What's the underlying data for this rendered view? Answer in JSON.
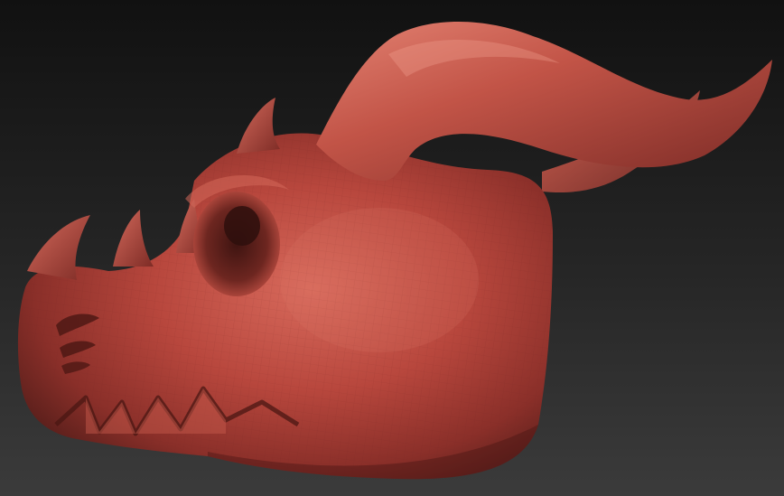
{
  "viewport": {
    "background_top": "#111111",
    "background_bottom": "#3b3b3b"
  },
  "model": {
    "subject": "dragon-head-sculpt",
    "base_color": "#b8473d",
    "shadow_color": "#5a1f1b",
    "highlight_color": "#e07a6a"
  }
}
